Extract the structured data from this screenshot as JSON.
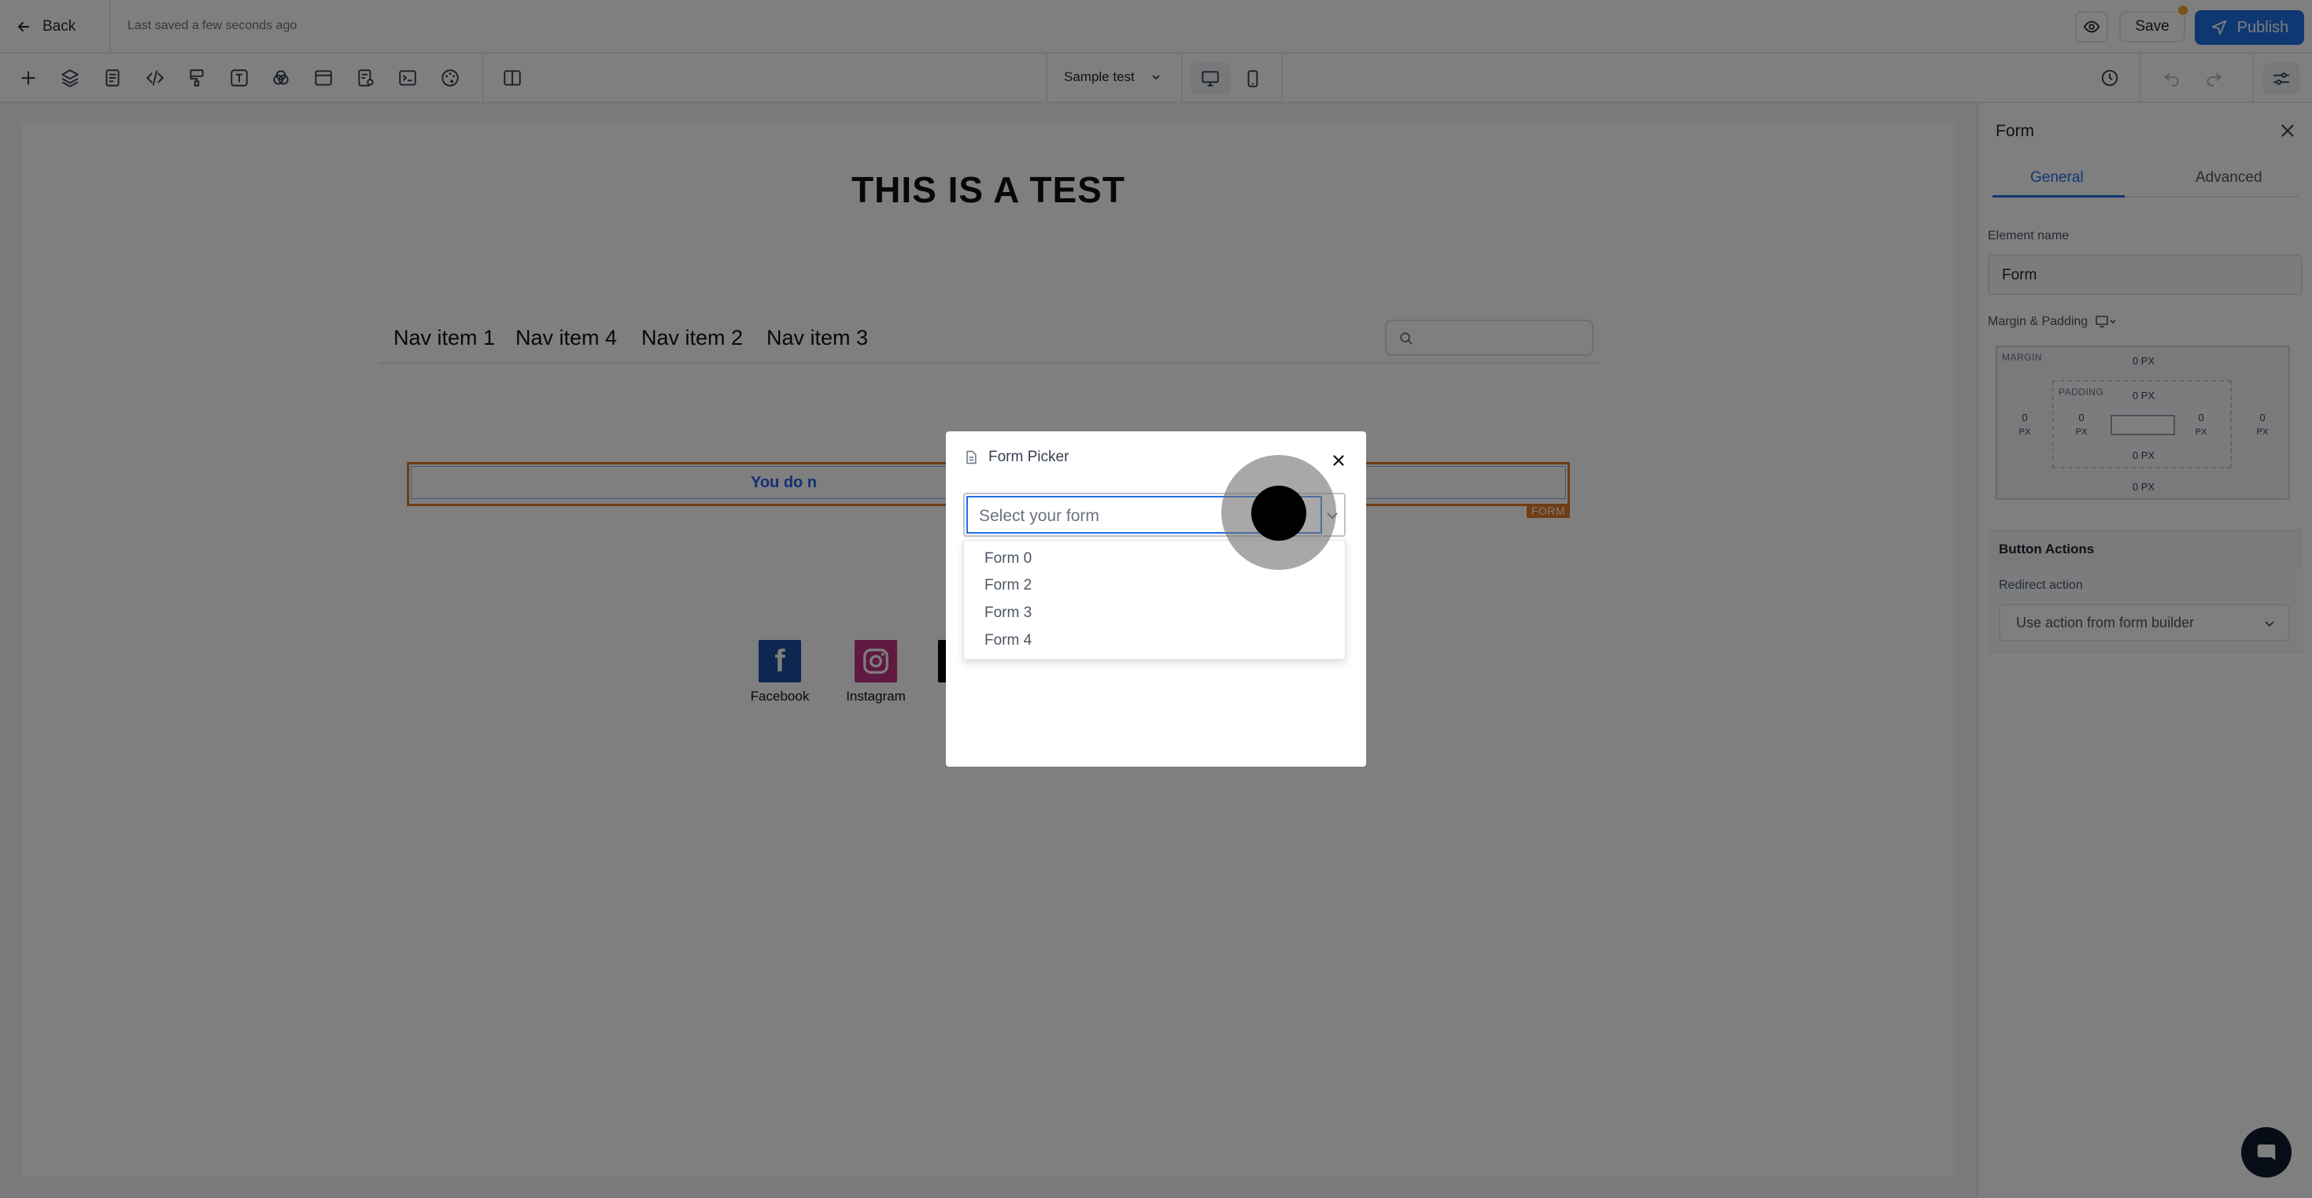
{
  "header": {
    "back_label": "Back",
    "saved_status": "Last saved a few seconds ago",
    "save_label": "Save",
    "publish_label": "Publish"
  },
  "toolbar": {
    "tools": [
      "add-icon",
      "layers-icon",
      "pages-icon",
      "code-icon",
      "paint-roller-icon",
      "text-icon",
      "shapes-icon",
      "layout-icon",
      "form-search-icon",
      "terminal-icon",
      "theme-palette-icon",
      "columns-icon"
    ],
    "page_selector": "Sample test",
    "devices": [
      "desktop-icon",
      "mobile-icon"
    ]
  },
  "canvas": {
    "title": "THIS IS A TEST",
    "nav_items": [
      "Nav item 1",
      "Nav item 4",
      "Nav item 2",
      "Nav item 3"
    ],
    "form_notice": "You do n",
    "form_badge": "FORM",
    "social": [
      {
        "label": "Facebook",
        "icon": "facebook-icon"
      },
      {
        "label": "Instagram",
        "icon": "instagram-icon"
      }
    ]
  },
  "panel": {
    "title": "Form",
    "tabs": [
      "General",
      "Advanced"
    ],
    "active_tab": "General",
    "element_name_label": "Element name",
    "element_name_value": "Form",
    "margin_padding_label": "Margin & Padding",
    "margin_tag": "MARGIN",
    "padding_tag": "PADDING",
    "margin": {
      "top": "0 PX",
      "bottom": "0 PX",
      "left": "0",
      "right": "0",
      "unit": "PX"
    },
    "padding": {
      "top": "0 PX",
      "bottom": "0 PX",
      "left": "0",
      "right": "0",
      "unit": "PX"
    },
    "button_actions_label": "Button Actions",
    "redirect_label": "Redirect action",
    "redirect_value": "Use action from form builder"
  },
  "modal": {
    "title": "Form Picker",
    "placeholder": "Select your form",
    "options": [
      "Form 0",
      "Form 2",
      "Form 3",
      "Form 4"
    ]
  },
  "colors": {
    "accent": "#1f6fe5",
    "form_outline": "#e07a2b",
    "notify": "#f5a524"
  }
}
